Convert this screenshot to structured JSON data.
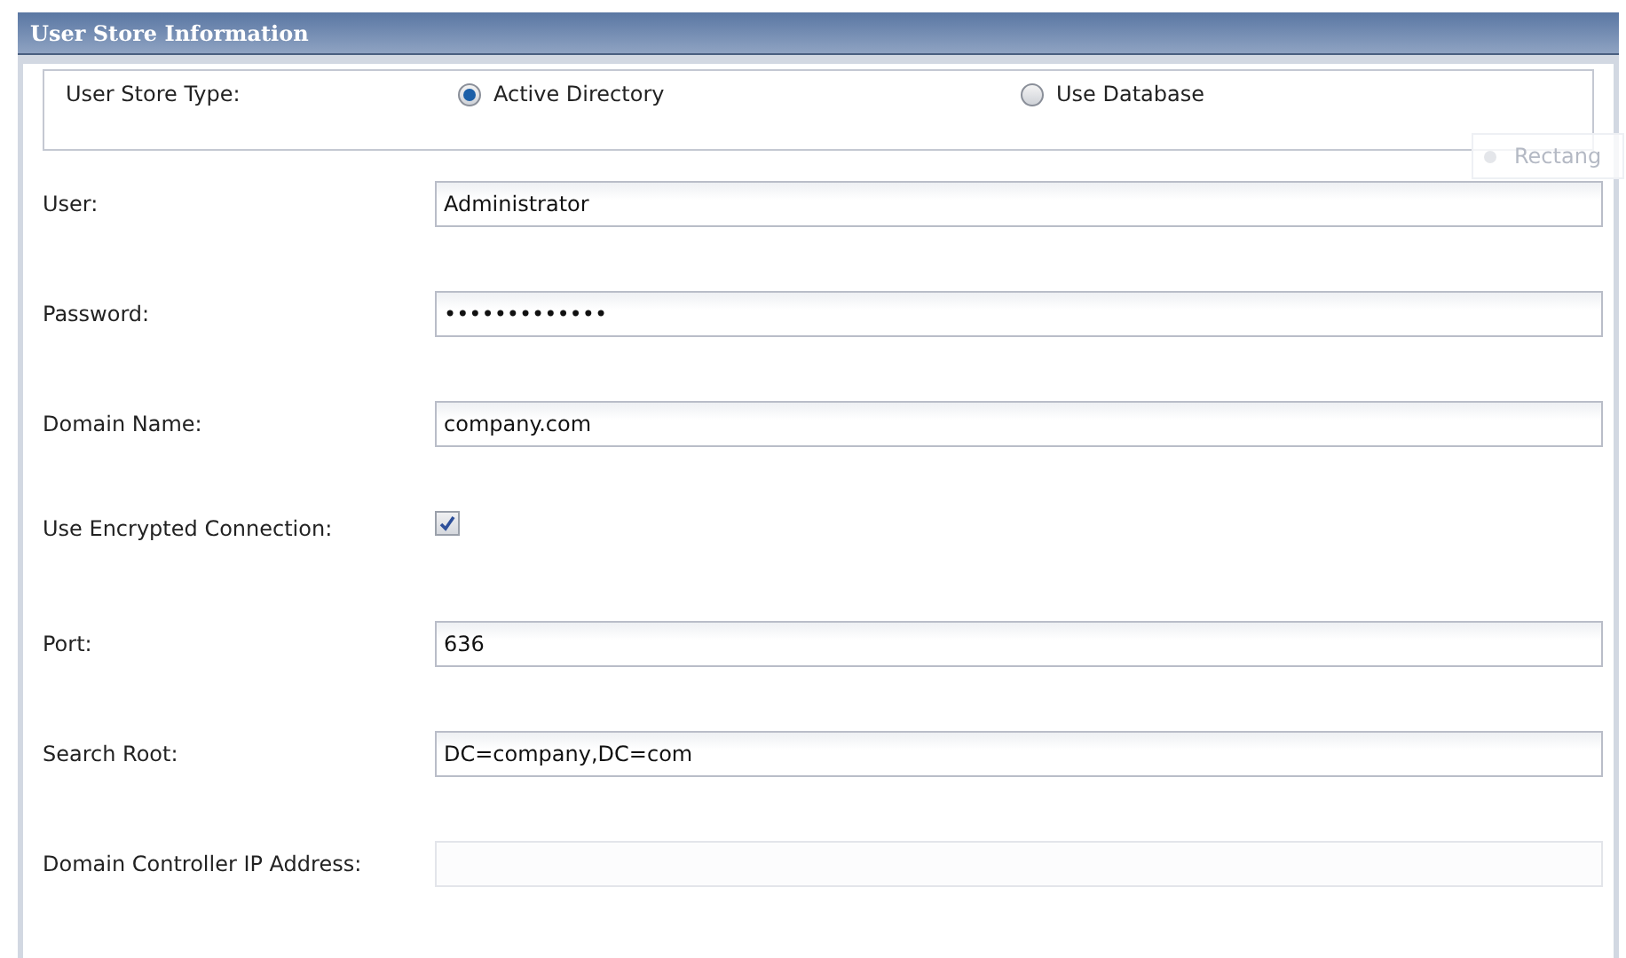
{
  "panel": {
    "title": "User Store Information"
  },
  "store_type": {
    "label": "User Store Type:",
    "options": [
      {
        "label": "Active Directory",
        "selected": true
      },
      {
        "label": "Use Database",
        "selected": false
      }
    ]
  },
  "ghost_tooltip": {
    "text": "Rectang"
  },
  "fields": [
    {
      "kind": "text",
      "label": "User:",
      "value": "Administrator",
      "disabled": false
    },
    {
      "kind": "text",
      "label": "Password:",
      "value": "•••••••••••••",
      "disabled": false
    },
    {
      "kind": "text",
      "label": "Domain Name:",
      "value": "company.com",
      "disabled": false
    },
    {
      "kind": "checkbox",
      "label": "Use Encrypted Connection:",
      "checked": true
    },
    {
      "kind": "text",
      "label": "Port:",
      "value": "636",
      "disabled": false
    },
    {
      "kind": "text",
      "label": "Search Root:",
      "value": "DC=company,DC=com",
      "disabled": false
    },
    {
      "kind": "text",
      "label": "Domain Controller IP Address:",
      "disabled": true
    }
  ]
}
